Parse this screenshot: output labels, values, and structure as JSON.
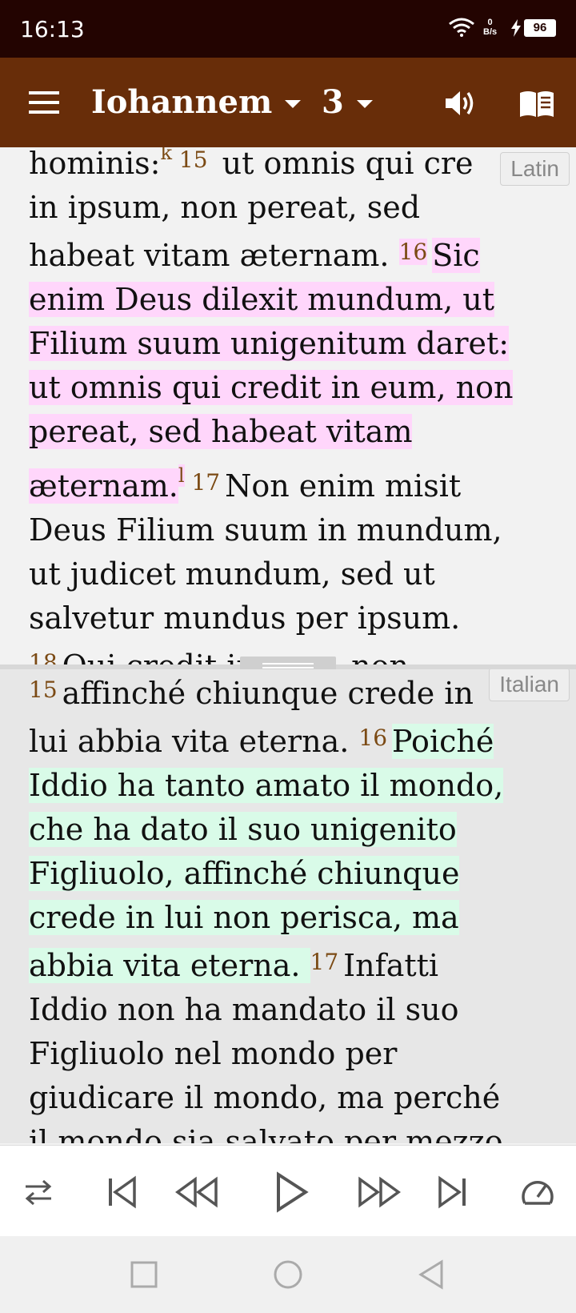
{
  "status_bar": {
    "time": "16:13",
    "net_speed_value": "0",
    "net_speed_unit": "B/s",
    "battery": "96"
  },
  "app_bar": {
    "book": "Iohannem",
    "chapter": "3"
  },
  "top_pane": {
    "language": "Latin",
    "lines": [
      {
        "segments": [
          {
            "text": "hominis:"
          },
          {
            "fn": "k"
          },
          {
            "vnum": " 15"
          },
          {
            "text": " ut omnis qui cre"
          }
        ]
      },
      {
        "segments": [
          {
            "text": "in ipsum, non pereat, sed"
          }
        ]
      },
      {
        "segments": [
          {
            "text": "habeat vitam æternam. "
          },
          {
            "vnum": "16",
            "hl": true
          },
          {
            "text": "Sic",
            "hl": true
          }
        ]
      },
      {
        "segments": [
          {
            "text": "enim Deus dilexit mundum, ut",
            "hl": true
          }
        ]
      },
      {
        "segments": [
          {
            "text": "Filium suum unigenitum daret:",
            "hl": true
          }
        ]
      },
      {
        "segments": [
          {
            "text": "ut omnis qui credit in eum, non",
            "hl": true
          }
        ]
      },
      {
        "segments": [
          {
            "text": "pereat, sed habeat vitam",
            "hl": true
          }
        ]
      },
      {
        "segments": [
          {
            "text": "æternam.",
            "hl": true
          },
          {
            "fn": "l",
            "hl": true
          },
          {
            "vnum": " 17"
          },
          {
            "text": "Non enim misit"
          }
        ]
      },
      {
        "segments": [
          {
            "text": "Deus Filium suum in mundum,"
          }
        ]
      },
      {
        "segments": [
          {
            "text": "ut judicet mundum, sed ut"
          }
        ]
      },
      {
        "segments": [
          {
            "text": "salvetur mundus per ipsum."
          }
        ]
      },
      {
        "segments": [
          {
            "vnum": "18"
          },
          {
            "text": "Qui credit in eum, non"
          }
        ]
      }
    ]
  },
  "bottom_pane": {
    "language": "Italian",
    "lines": [
      {
        "segments": [
          {
            "vnum": "15"
          },
          {
            "text": "affinché chiunque crede in"
          }
        ]
      },
      {
        "segments": [
          {
            "text": "lui abbia vita eterna. "
          },
          {
            "vnum": "16"
          },
          {
            "text": "Poiché",
            "hl": true
          }
        ]
      },
      {
        "segments": [
          {
            "text": "Iddio ha tanto amato il mondo,",
            "hl": true
          }
        ]
      },
      {
        "segments": [
          {
            "text": "che ha dato il suo unigenito",
            "hl": true
          }
        ]
      },
      {
        "segments": [
          {
            "text": "Figliuolo, affinché chiunque",
            "hl": true
          }
        ]
      },
      {
        "segments": [
          {
            "text": "crede in lui non perisca, ma",
            "hl": true
          }
        ]
      },
      {
        "segments": [
          {
            "text": "abbia vita eterna. ",
            "hl": true
          },
          {
            "vnum": "17"
          },
          {
            "text": "Infatti"
          }
        ]
      },
      {
        "segments": [
          {
            "text": "Iddio non ha mandato il suo"
          }
        ]
      },
      {
        "segments": [
          {
            "text": "Figliuolo nel mondo per"
          }
        ]
      },
      {
        "segments": [
          {
            "text": "giudicare il mondo, ma perché"
          }
        ]
      },
      {
        "segments": [
          {
            "text": "il mondo sia salvato per mezzo"
          }
        ]
      }
    ]
  },
  "player": {
    "buttons": [
      {
        "name": "repeat-mode-icon"
      },
      {
        "name": "skip-previous-icon"
      },
      {
        "name": "rewind-icon"
      },
      {
        "name": "play-icon"
      },
      {
        "name": "fast-forward-icon"
      },
      {
        "name": "skip-next-icon"
      },
      {
        "name": "playback-speed-icon"
      }
    ]
  },
  "nav_bar": {
    "buttons": [
      "recents-icon",
      "home-icon",
      "back-icon"
    ]
  },
  "colors": {
    "status_bar": "#230401",
    "app_bar": "#682d09",
    "verse_number": "#7b4a14",
    "highlight_pink": "#ffd6fb",
    "highlight_green": "#d9fbe8"
  }
}
